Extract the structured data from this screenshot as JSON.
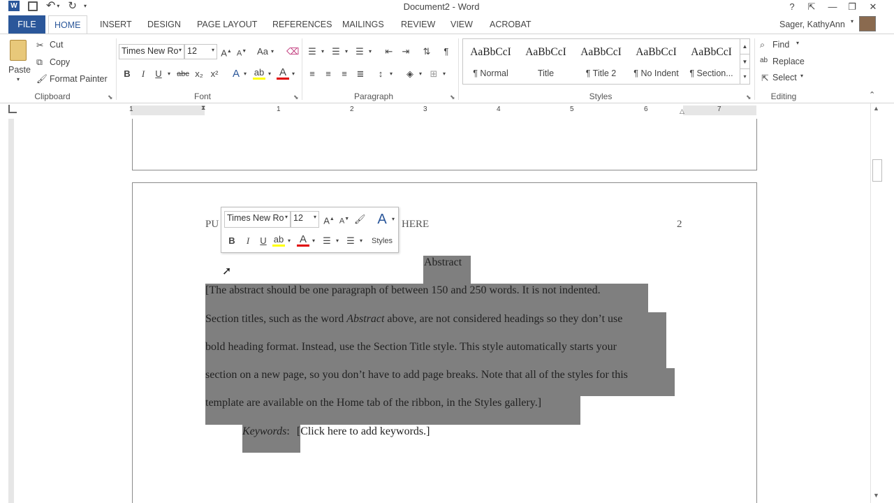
{
  "window": {
    "title": "Document2 - Word",
    "help": "?",
    "user": "Sager, KathyAnn"
  },
  "tabs": [
    "FILE",
    "HOME",
    "INSERT",
    "DESIGN",
    "PAGE LAYOUT",
    "REFERENCES",
    "MAILINGS",
    "REVIEW",
    "VIEW",
    "ACROBAT"
  ],
  "clipboard": {
    "paste": "Paste",
    "cut": "Cut",
    "copy": "Copy",
    "format_painter": "Format Painter",
    "label": "Clipboard"
  },
  "font": {
    "name": "Times New Ro",
    "size": "12",
    "change_case": "Aa",
    "label": "Font",
    "bold": "B",
    "italic": "I",
    "underline": "U",
    "strike": "abc",
    "subscript": "x₂",
    "superscript": "x²"
  },
  "paragraph": {
    "label": "Paragraph"
  },
  "styles": {
    "label": "Styles",
    "items": [
      {
        "sample": "AaBbCcI",
        "name": "¶ Normal"
      },
      {
        "sample": "AaBbCcI",
        "name": "Title"
      },
      {
        "sample": "AaBbCcI",
        "name": "¶ Title 2"
      },
      {
        "sample": "AaBbCcI",
        "name": "¶ No Indent"
      },
      {
        "sample": "AaBbCcI",
        "name": "¶ Section..."
      }
    ]
  },
  "editing": {
    "find": "Find",
    "replace": "Replace",
    "select": "Select",
    "label": "Editing"
  },
  "ruler": {
    "numbers": [
      "1",
      "1",
      "2",
      "3",
      "4",
      "5",
      "6",
      "7"
    ]
  },
  "document": {
    "header_left_a": "PU",
    "header_left_b": "HERE",
    "page_number": "2",
    "heading": "Abstract",
    "line1": "[The abstract should be one paragraph of between 150 and 250 words.  It is not indented.",
    "line2_a": "Section titles, such as the word ",
    "line2_em": "Abstract",
    "line2_b": " above, are not considered headings so they don’t use",
    "line3": "bold heading format.  Instead, use the Section Title style.  This style automatically starts your",
    "line4": "section on a new page, so you don’t have to add page breaks.  Note that all of the styles for this",
    "line5": "template are available on the Home tab of the ribbon, in the Styles gallery.]",
    "keywords_label": "Keywords",
    "keywords_colon": ":",
    "keywords_value": "[Click here to add keywords.]"
  },
  "minibar": {
    "font": "Times New Ro",
    "size": "12",
    "styles": "Styles"
  },
  "colors": {
    "file_tab": "#2b579a",
    "highlight": "#7f7f7f",
    "font_color_bar": "#e00000"
  }
}
